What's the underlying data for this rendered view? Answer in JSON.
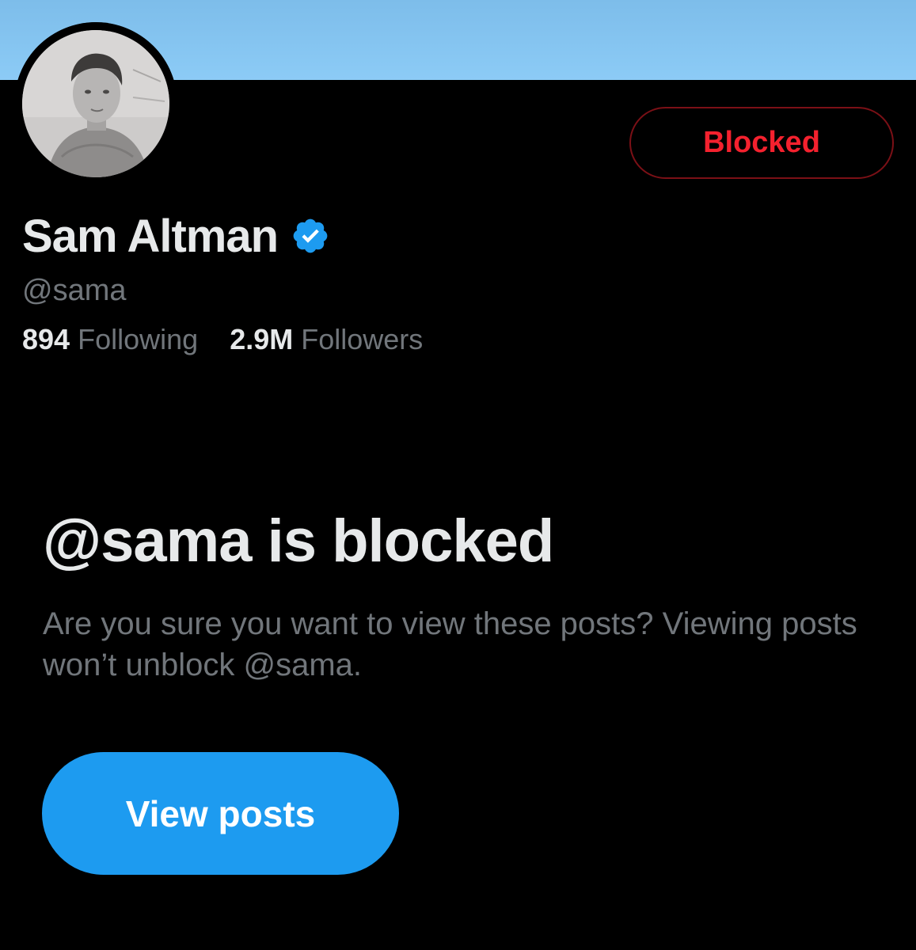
{
  "profile": {
    "display_name": "Sam Altman",
    "handle": "@sama",
    "verified_icon": "verified-badge-icon",
    "following_count": "894",
    "following_label": "Following",
    "followers_count": "2.9M",
    "followers_label": "Followers"
  },
  "actions": {
    "blocked_label": "Blocked"
  },
  "blocked_notice": {
    "title": "@sama is blocked",
    "description": "Are you sure you want to view these posts? Viewing posts won’t unblock @sama.",
    "view_posts_label": "View posts"
  },
  "colors": {
    "background": "#000000",
    "banner": "#8ccbf6",
    "accent_blue": "#1d9bf0",
    "blocked_red": "#f4212e",
    "text_primary": "#e7e9ea",
    "text_secondary": "#71767b"
  }
}
